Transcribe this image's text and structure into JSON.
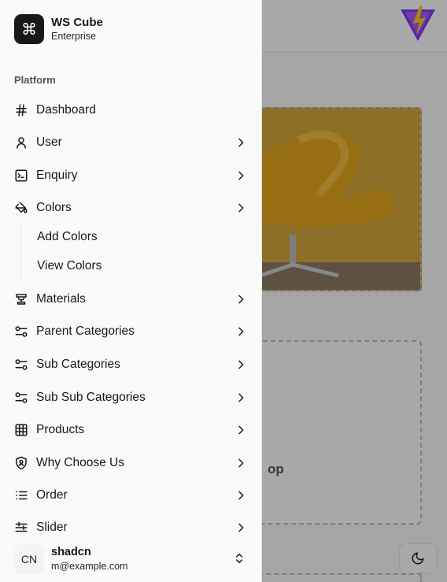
{
  "brand": {
    "name": "WS Cube",
    "subtitle": "Enterprise",
    "icon": "command-icon"
  },
  "sidebar": {
    "group_label": "Platform",
    "items": [
      {
        "label": "Dashboard",
        "icon": "hash-icon",
        "chevron": false
      },
      {
        "label": "User",
        "icon": "user-icon",
        "chevron": true
      },
      {
        "label": "Enquiry",
        "icon": "terminal-icon",
        "chevron": true
      },
      {
        "label": "Colors",
        "icon": "paint-bucket-icon",
        "chevron": true,
        "expanded": true
      },
      {
        "label": "Materials",
        "icon": "materials-icon",
        "chevron": true
      },
      {
        "label": "Parent Categories",
        "icon": "sliders-icon",
        "chevron": true
      },
      {
        "label": "Sub Categories",
        "icon": "sliders-icon",
        "chevron": true
      },
      {
        "label": "Sub Sub Categories",
        "icon": "sliders-icon",
        "chevron": true
      },
      {
        "label": "Products",
        "icon": "table-icon",
        "chevron": true
      },
      {
        "label": "Why Choose Us",
        "icon": "shield-icon",
        "chevron": true
      },
      {
        "label": "Order",
        "icon": "list-icon",
        "chevron": true
      },
      {
        "label": "Slider",
        "icon": "slider-icon",
        "chevron": true
      }
    ],
    "colors_submenu": [
      "Add Colors",
      "View Colors"
    ]
  },
  "user": {
    "initials": "CN",
    "name": "shadcn",
    "email": "m@example.com"
  },
  "background": {
    "upload_text_fragment": "op"
  },
  "colors": {
    "accent": "#18181b",
    "sidebar_bg": "#fafafa",
    "chair": "#d9a62a"
  }
}
